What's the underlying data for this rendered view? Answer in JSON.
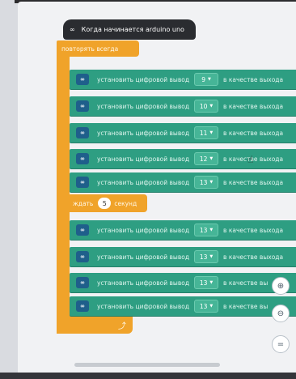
{
  "hat_block": {
    "icon": "infinity-icon",
    "label": "Когда начинается arduino uno"
  },
  "loop_block": {
    "label": "повторять всегда"
  },
  "wait_block": {
    "prefix": "ждать",
    "value": "5",
    "suffix": "секунд"
  },
  "write_blocks_top": [
    {
      "label": "установить цифровой вывод",
      "pin": "9",
      "mode": "в качестве выхода"
    },
    {
      "label": "установить цифровой вывод",
      "pin": "10",
      "mode": "в качестве выхода"
    },
    {
      "label": "установить цифровой вывод",
      "pin": "11",
      "mode": "в качестве выхода"
    },
    {
      "label": "установить цифровой вывод",
      "pin": "12",
      "mode": "в качестве выхода"
    },
    {
      "label": "установить цифровой вывод",
      "pin": "13",
      "mode": "в качестве выхода"
    }
  ],
  "write_blocks_bottom": [
    {
      "label": "установить цифровой вывод",
      "pin": "13",
      "mode": "в качестве выхода"
    },
    {
      "label": "установить цифровой вывод",
      "pin": "13",
      "mode": "в качестве выхода"
    },
    {
      "label": "установить цифровой вывод",
      "pin": "13",
      "mode": "в качестве вы"
    },
    {
      "label": "установить цифровой вывод",
      "pin": "13",
      "mode": "в качестве вы"
    }
  ],
  "zoom_controls": {
    "zoom_in_icon": "zoom-in-icon",
    "zoom_out_icon": "zoom-out-icon",
    "reset_icon": "equals-icon"
  },
  "colors": {
    "output_block": "#2e9e82",
    "control_block": "#f0a32a",
    "hat_block": "#2a2c30",
    "icon_bg": "#1f5f8b"
  }
}
